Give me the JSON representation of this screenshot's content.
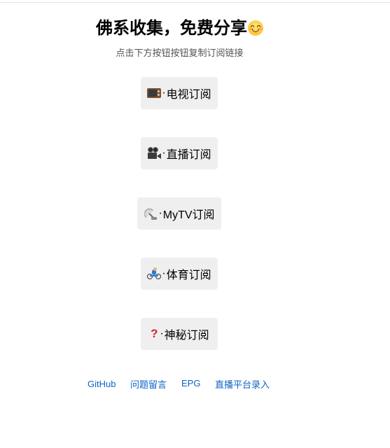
{
  "header": {
    "title": "佛系收集，免费分享",
    "title_emoji": "smiling-face-icon",
    "subtitle": "点击下方按钮按钮复制订阅链接"
  },
  "buttons": [
    {
      "icon": "television-icon",
      "label": "电视订阅"
    },
    {
      "icon": "movie-camera-icon",
      "label": "直播订阅"
    },
    {
      "icon": "satellite-antenna-icon",
      "label": "MyTV订阅"
    },
    {
      "icon": "cyclist-icon",
      "label": "体育订阅"
    },
    {
      "icon": "red-question-mark-icon",
      "label": "神秘订阅"
    }
  ],
  "separator": "·",
  "footer": {
    "links": [
      "GitHub",
      "问题留言",
      "EPG",
      "直播平台录入"
    ]
  },
  "colors": {
    "button_bg": "#efefef",
    "link": "#0d63c6",
    "subtitle": "#555555"
  }
}
